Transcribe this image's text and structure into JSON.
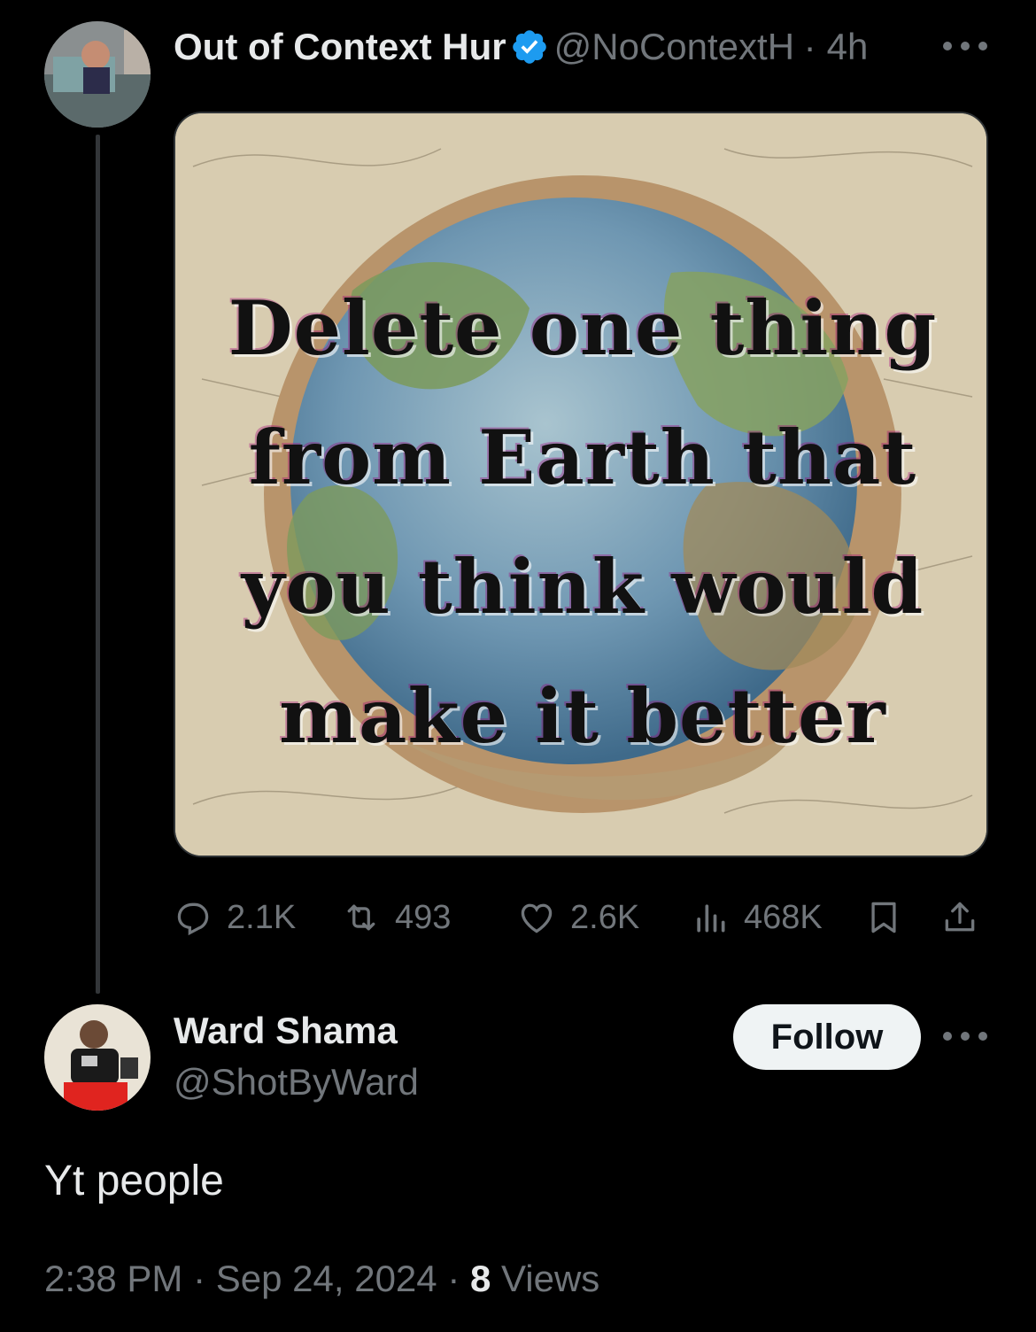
{
  "tweet": {
    "display_name": "Out of Context Hur",
    "handle": "@NoContextH",
    "separator": "·",
    "time": "4h",
    "image_text": [
      "Delete one thing",
      "from Earth that",
      "you think would",
      "make it better"
    ],
    "stats": {
      "replies": "2.1K",
      "retweets": "493",
      "likes": "2.6K",
      "views": "468K"
    }
  },
  "reply": {
    "display_name": "Ward Shama",
    "handle": "@ShotByWard",
    "follow_label": "Follow",
    "text": "Yt people",
    "time": "2:38 PM",
    "date": "Sep 24, 2024",
    "separator": "·",
    "views_count": "8",
    "views_label": "Views"
  },
  "colors": {
    "background": "#000000",
    "text": "#e7e9ea",
    "muted": "#71767b",
    "verified": "#1d9bf0",
    "follow_bg": "#eff3f4"
  },
  "icons": {
    "reply": "reply-icon",
    "retweet": "retweet-icon",
    "like": "like-icon",
    "views": "views-icon",
    "bookmark": "bookmark-icon",
    "share": "share-icon",
    "more": "more-icon",
    "verified": "verified-badge-icon"
  }
}
